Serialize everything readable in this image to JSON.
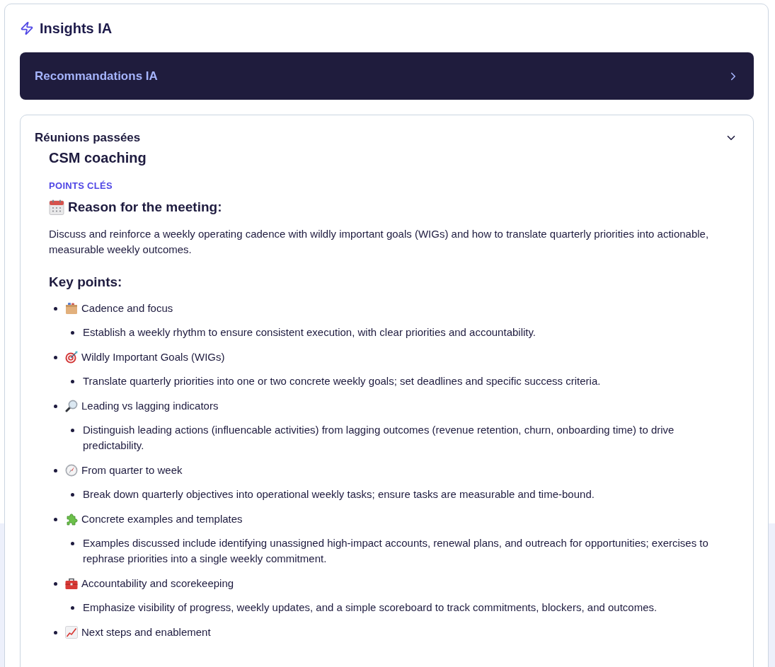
{
  "panel": {
    "title": "Insights IA"
  },
  "recommendations": {
    "title": "Recommandations IA",
    "expanded": false
  },
  "past_meetings": {
    "title": "Réunions passées",
    "expanded": true,
    "meeting": {
      "title": "CSM coaching",
      "section_label": "POINTS CLÉS",
      "reason_heading": "Reason for the meeting:",
      "reason": "Discuss and reinforce a weekly operating cadence with wildly important goals (WIGs) and how to translate quarterly priorities into actionable, measurable weekly outcomes.",
      "key_points_heading": "Key points:",
      "key_points": [
        {
          "kind": "box",
          "title": "Cadence and focus",
          "details": [
            "Establish a weekly rhythm to ensure consistent execution, with clear priorities and accountability."
          ]
        },
        {
          "kind": "target",
          "title": "Wildly Important Goals (WIGs)",
          "details": [
            "Translate quarterly priorities into one or two concrete weekly goals; set deadlines and specific success criteria."
          ]
        },
        {
          "kind": "magnifier",
          "title": "Leading vs lagging indicators",
          "details": [
            "Distinguish leading actions (influencable activities) from lagging outcomes (revenue retention, churn, onboarding time) to drive predictability."
          ]
        },
        {
          "kind": "compass",
          "title": "From quarter to week",
          "details": [
            "Break down quarterly objectives into operational weekly tasks; ensure tasks are measurable and time-bound."
          ]
        },
        {
          "kind": "puzzle",
          "title": "Concrete examples and templates",
          "details": [
            "Examples discussed include identifying unassigned high-impact accounts, renewal plans, and outreach for opportunities; exercises to rephrase priorities into a single weekly commitment."
          ]
        },
        {
          "kind": "toolbox",
          "title": "Accountability and scorekeeping",
          "details": [
            "Emphasize visibility of progress, weekly updates, and a simple scoreboard to track commitments, blockers, and outcomes."
          ]
        },
        {
          "kind": "chart",
          "title": "Next steps and enablement"
        }
      ]
    }
  }
}
